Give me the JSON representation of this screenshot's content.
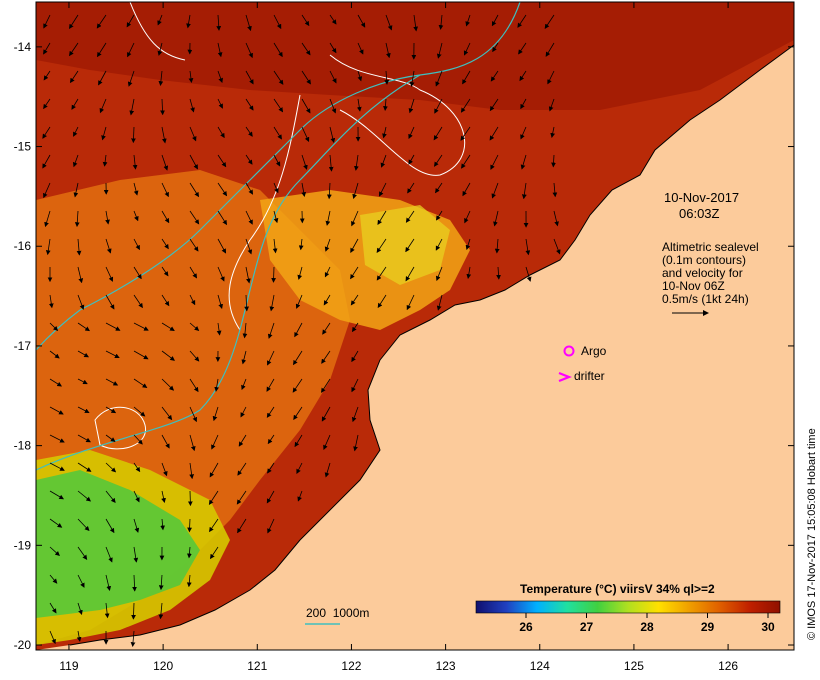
{
  "map": {
    "x_ticks": [
      "119",
      "120",
      "121",
      "122",
      "123",
      "124",
      "125",
      "126"
    ],
    "y_ticks": [
      "-14",
      "-15",
      "-16",
      "-17",
      "-18",
      "-19",
      "-20"
    ],
    "lon_range": [
      118.65,
      126.7
    ],
    "lat_range": [
      -13.55,
      -20.05
    ],
    "land_color": "#fccb9b",
    "contour_color": "#ffffff",
    "isobath_color": "#3fbfbf"
  },
  "annotation": {
    "date": "10-Nov-2017",
    "time": "06:03Z",
    "altimetry": "Altimetric sealevel\n(0.1m contours)\nand velocity for\n10-Nov 06Z\n0.5m/s (1kt 24h)",
    "argo": "Argo",
    "drifter": "drifter",
    "argo_color": "#ff00ff",
    "drifter_color": "#ff00ff"
  },
  "depth_legend": {
    "label": "200  1000m"
  },
  "colorbar": {
    "title": "Temperature (°C) viirsV 34% ql>=2",
    "ticks": [
      "26",
      "27",
      "28",
      "29",
      "30"
    ],
    "stops": [
      "#10106e",
      "#2040c0",
      "#00b0ff",
      "#20e0a0",
      "#40d040",
      "#b0e020",
      "#ffe000",
      "#f0a000",
      "#e06000",
      "#c02000",
      "#901000"
    ]
  },
  "credit": "© IMOS 17-Nov-2017 15:05:08 Hobart time"
}
